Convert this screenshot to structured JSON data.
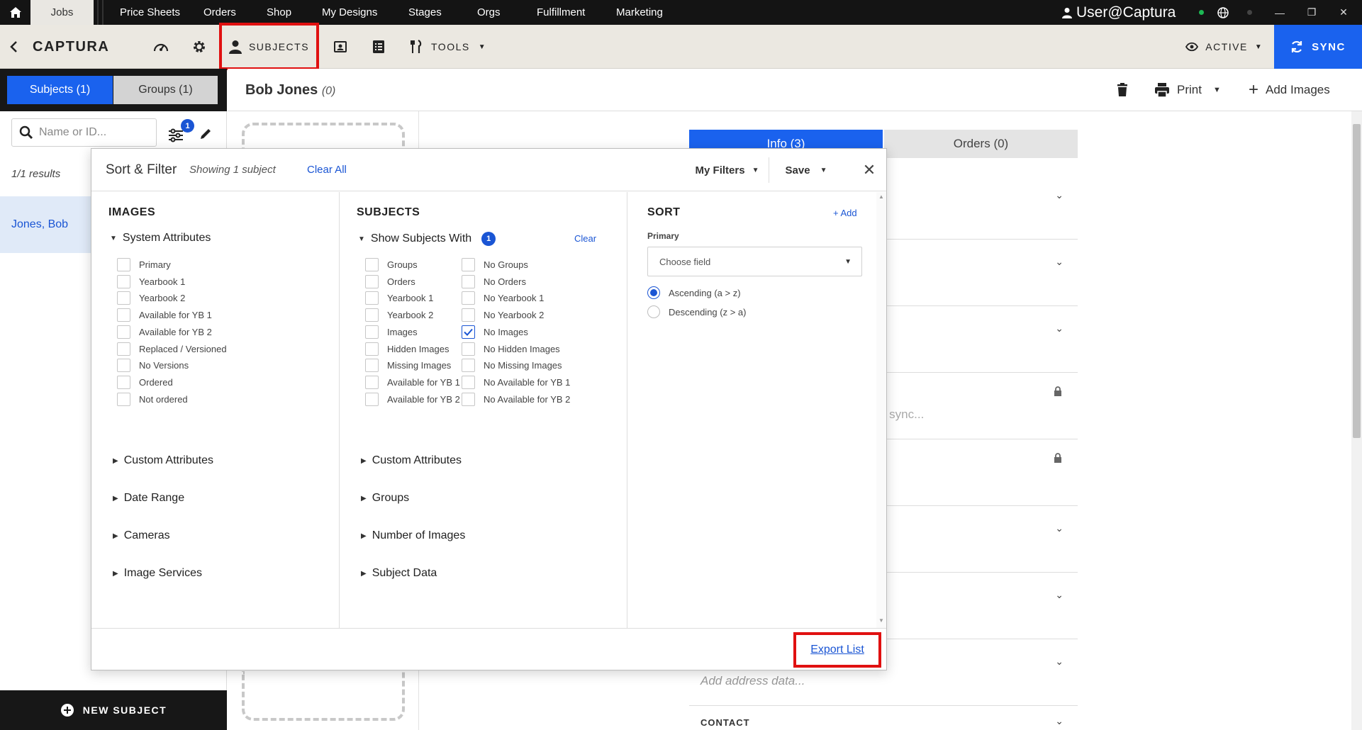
{
  "topnav": {
    "jobs": "Jobs",
    "items": [
      "Price Sheets",
      "Orders",
      "Shop",
      "My Designs",
      "Stages",
      "Orgs",
      "Fulfillment",
      "Marketing"
    ],
    "user": "User@Captura"
  },
  "toolbar": {
    "brand": "CAPTURA",
    "subjects_label": "SUBJECTS",
    "tools_label": "TOOLS",
    "active_label": "ACTIVE",
    "sync_label": "SYNC"
  },
  "left": {
    "tab_subjects": "Subjects (1)",
    "tab_groups": "Groups (1)",
    "search_placeholder": "Name or ID...",
    "filter_count": "1",
    "results": "1/1 results",
    "subject": "Jones, Bob",
    "new_subject": "NEW SUBJECT"
  },
  "header": {
    "name": "Bob Jones",
    "count": "(0)",
    "print_label": "Print",
    "add_images_label": "Add Images"
  },
  "info_tabs": {
    "info": "Info (3)",
    "orders": "Orders (0)"
  },
  "background": {
    "sync_text": "n sync...",
    "address_placeholder": "Add address data...",
    "contact_label": "CONTACT"
  },
  "modal": {
    "title": "Sort & Filter",
    "subtitle": "Showing 1 subject",
    "clear_all": "Clear All",
    "my_filters": "My Filters",
    "save": "Save",
    "images": {
      "heading": "IMAGES",
      "system_attributes": "System Attributes",
      "checkboxes": [
        "Primary",
        "Yearbook 1",
        "Yearbook 2",
        "Available for YB 1",
        "Available for YB 2",
        "Replaced / Versioned",
        "No Versions",
        "Ordered",
        "Not ordered"
      ],
      "groups": [
        "Custom Attributes",
        "Date Range",
        "Cameras",
        "Image Services"
      ]
    },
    "subjects": {
      "heading": "SUBJECTS",
      "show_with": "Show Subjects With",
      "show_with_count": "1",
      "clear": "Clear",
      "left_checkboxes": [
        "Groups",
        "Orders",
        "Yearbook 1",
        "Yearbook 2",
        "Images",
        "Hidden Images",
        "Missing Images",
        "Available for YB 1",
        "Available for YB 2"
      ],
      "right_checkboxes": [
        "No Groups",
        "No Orders",
        "No Yearbook 1",
        "No Yearbook 2",
        "No Images",
        "No Hidden Images",
        "No Missing Images",
        "No Available for YB 1",
        "No Available for YB 2"
      ],
      "checked": "No Images",
      "groups": [
        "Custom Attributes",
        "Groups",
        "Number of Images",
        "Subject Data"
      ]
    },
    "sort": {
      "heading": "SORT",
      "add": "+ Add",
      "primary_label": "Primary",
      "choose_field": "Choose field",
      "ascending": "Ascending (a > z)",
      "descending": "Descending (z > a)"
    },
    "export_list": "Export List"
  },
  "colors": {
    "accent": "#1a62ee",
    "highlight_box": "#e01010",
    "nav_bg": "#141414",
    "toolbar_bg": "#ebe8e1"
  }
}
